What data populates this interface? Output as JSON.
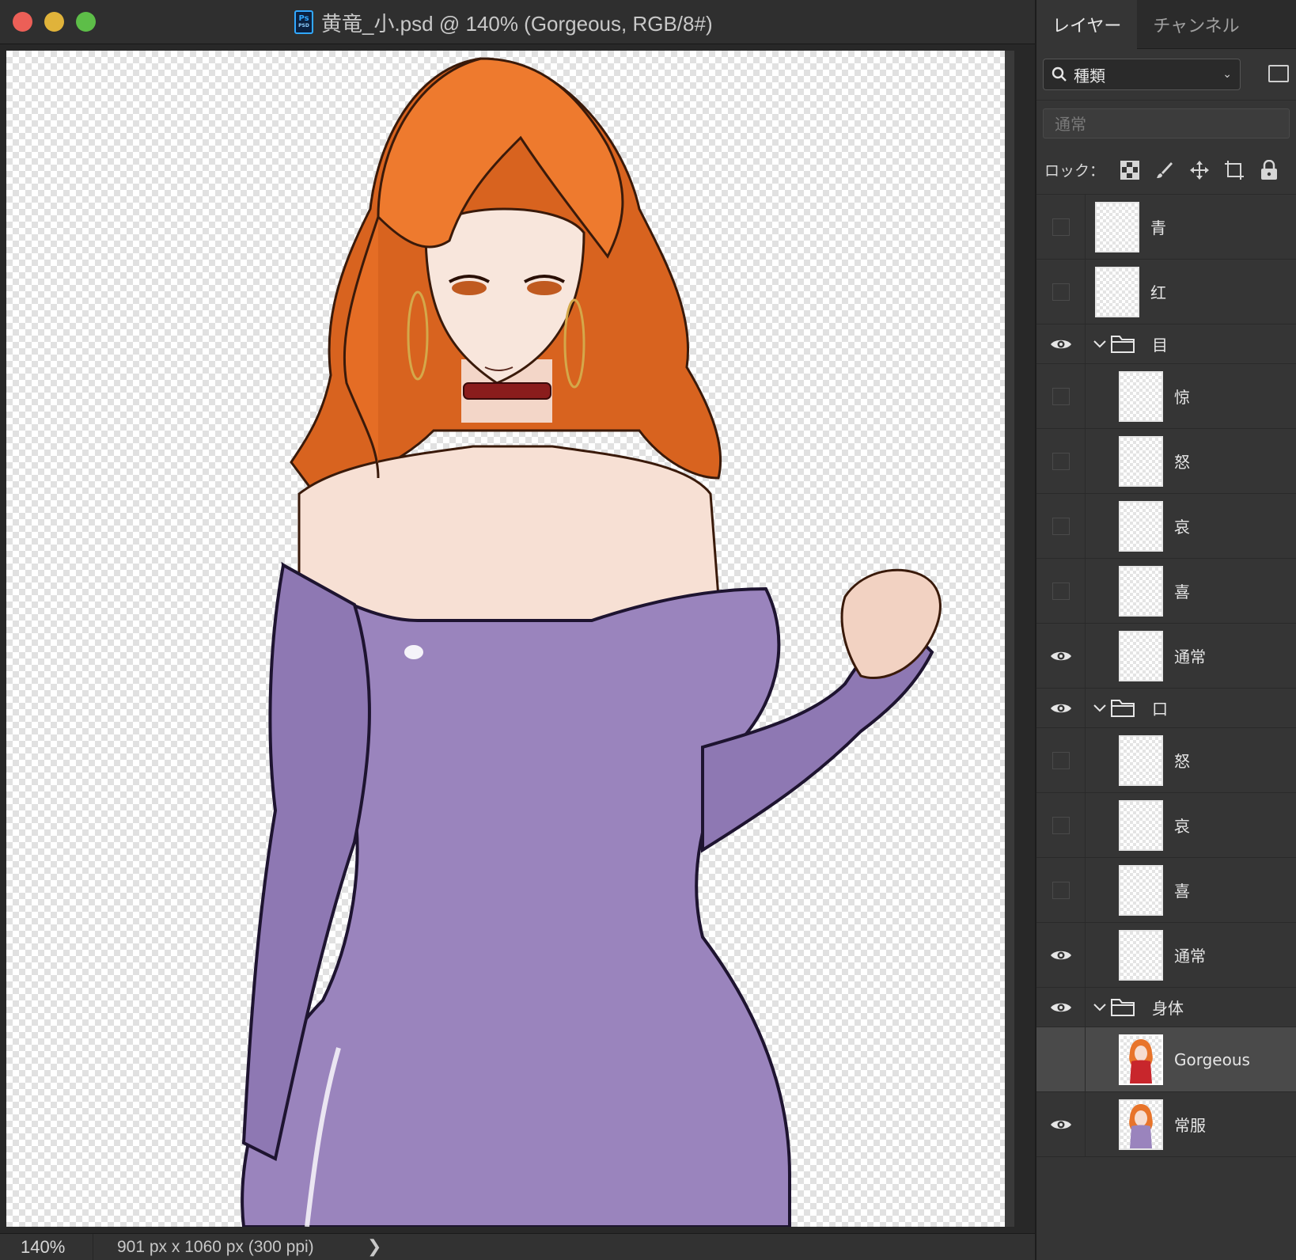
{
  "window": {
    "title": "黄竜_小.psd @ 140% (Gorgeous, RGB/8#)",
    "ps_icon": "Ps",
    "ps_icon_sub": "PSD"
  },
  "status": {
    "zoom": "140%",
    "doc_size": "901 px x 1060 px (300 ppi)",
    "arrow": "❯"
  },
  "panel": {
    "tabs": [
      "レイヤー",
      "チャンネル"
    ],
    "active_tab": 0,
    "filter_label": "種類",
    "blend_mode": "通常",
    "lock_label": "ロック："
  },
  "layers": [
    {
      "name": "青",
      "type": "layer",
      "level": 0,
      "visible": false
    },
    {
      "name": "红",
      "type": "layer",
      "level": 0,
      "visible": false
    },
    {
      "name": "目",
      "type": "group",
      "level": 0,
      "visible": true,
      "expanded": true
    },
    {
      "name": "惊",
      "type": "layer",
      "level": 1,
      "visible": false
    },
    {
      "name": "怒",
      "type": "layer",
      "level": 1,
      "visible": false
    },
    {
      "name": "哀",
      "type": "layer",
      "level": 1,
      "visible": false
    },
    {
      "name": "喜",
      "type": "layer",
      "level": 1,
      "visible": false
    },
    {
      "name": "通常",
      "type": "layer",
      "level": 1,
      "visible": true
    },
    {
      "name": "口",
      "type": "group",
      "level": 0,
      "visible": true,
      "expanded": true
    },
    {
      "name": "怒",
      "type": "layer",
      "level": 1,
      "visible": false
    },
    {
      "name": "哀",
      "type": "layer",
      "level": 1,
      "visible": false
    },
    {
      "name": "喜",
      "type": "layer",
      "level": 1,
      "visible": false
    },
    {
      "name": "通常",
      "type": "layer",
      "level": 1,
      "visible": true
    },
    {
      "name": "身体",
      "type": "group",
      "level": 0,
      "visible": true,
      "expanded": true
    },
    {
      "name": "Gorgeous",
      "type": "layer",
      "level": 1,
      "visible": false,
      "selected": true,
      "thumb": "portrait-red"
    },
    {
      "name": "常服",
      "type": "layer",
      "level": 1,
      "visible": true,
      "thumb": "portrait-purple"
    }
  ],
  "colors": {
    "hair": "#e8742a",
    "dress": "#9a84bd",
    "skin": "#f6ddd0",
    "choker": "#8a1c1c",
    "panel_bg": "#353535"
  }
}
